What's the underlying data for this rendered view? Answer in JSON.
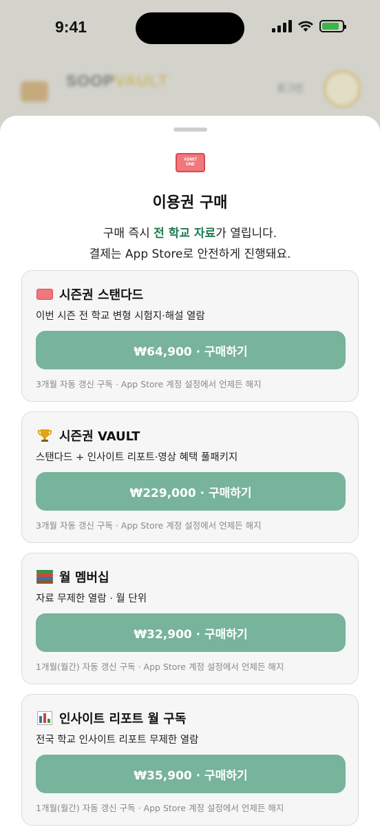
{
  "status_bar": {
    "time": "9:41",
    "icons": [
      "signal-icon",
      "wifi-icon",
      "battery-charging-icon"
    ],
    "battery_level": 0.85
  },
  "background_app": {
    "logo_part1": "SOOP",
    "logo_part2": "VAULT",
    "subtitle": "",
    "login_label": "로그인"
  },
  "sheet": {
    "icon": "admit-one-ticket-icon",
    "ticket_text_1": "ADMIT",
    "ticket_text_2": "ONE",
    "title": "이용권 구매",
    "intro_pre": "구매 즉시 ",
    "intro_highlight": "전 학교 자료",
    "intro_post": "가 열립니다.",
    "intro_line2": "결제는 App Store로 안전하게 진행돼요.",
    "accent_color": "#1f7a4d",
    "button_color": "#78b39c"
  },
  "plans": [
    {
      "icon": "ticket-icon",
      "name": "시즌권 스탠다드",
      "desc": "이번 시즌 전 학교 변형 시험지·해설 열람",
      "button": "₩64,900 · 구매하기",
      "note": "3개월 자동 갱신 구독 · App Store 계정 설정에서 언제든 해지"
    },
    {
      "icon": "trophy-icon",
      "name": "시즌권 VAULT",
      "desc": "스탠다드 + 인사이트 리포트·영상 혜택 풀패키지",
      "button": "₩229,000 · 구매하기",
      "note": "3개월 자동 갱신 구독 · App Store 계정 설정에서 언제든 해지"
    },
    {
      "icon": "books-icon",
      "name": "월 멤버십",
      "desc": "자료 무제한 열람 · 월 단위",
      "button": "₩32,900 · 구매하기",
      "note": "1개월(월간) 자동 갱신 구독 · App Store 계정 설정에서 언제든 해지"
    },
    {
      "icon": "bar-chart-icon",
      "name": "인사이트 리포트 월 구독",
      "desc": "전국 학교 인사이트 리포트 무제한 열람",
      "button": "₩35,900 · 구매하기",
      "note": "1개월(월간) 자동 갱신 구독 · App Store 계정 설정에서 언제든 해지"
    }
  ]
}
